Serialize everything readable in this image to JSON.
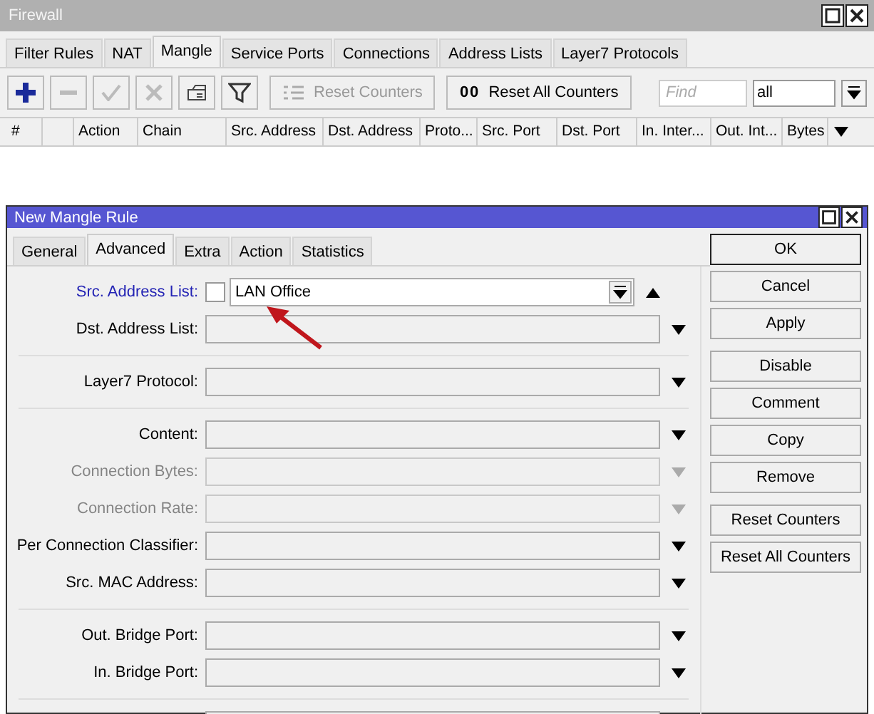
{
  "firewall": {
    "title": "Firewall",
    "tabs": [
      {
        "label": "Filter Rules",
        "selected": false
      },
      {
        "label": "NAT",
        "selected": false
      },
      {
        "label": "Mangle",
        "selected": true
      },
      {
        "label": "Service Ports",
        "selected": false
      },
      {
        "label": "Connections",
        "selected": false
      },
      {
        "label": "Address Lists",
        "selected": false
      },
      {
        "label": "Layer7 Protocols",
        "selected": false
      }
    ],
    "toolbar": [
      {
        "kind": "add",
        "disabled": false
      },
      {
        "kind": "remove",
        "disabled": true
      },
      {
        "kind": "enable",
        "disabled": true
      },
      {
        "kind": "disable",
        "disabled": true
      },
      {
        "kind": "comment",
        "disabled": false
      },
      {
        "kind": "filter",
        "disabled": false
      },
      {
        "kind": "reset",
        "label": "Reset Counters",
        "disabled": true
      },
      {
        "kind": "reset_all",
        "label": "Reset All Counters",
        "icon_text": "00",
        "disabled": false
      }
    ],
    "find": {
      "placeholder": "Find"
    },
    "filter": {
      "value": "all"
    },
    "columns": [
      "#",
      "",
      "Action",
      "Chain",
      "Src. Address",
      "Dst. Address",
      "Proto...",
      "Src. Port",
      "Dst. Port",
      "In. Inter...",
      "Out. Int...",
      "Bytes"
    ]
  },
  "dialog": {
    "title": "New Mangle Rule",
    "tabs": [
      {
        "label": "General",
        "selected": false
      },
      {
        "label": "Advanced",
        "selected": true
      },
      {
        "label": "Extra",
        "selected": false
      },
      {
        "label": "Action",
        "selected": false
      },
      {
        "label": "Statistics",
        "selected": false
      }
    ],
    "groups": [
      [
        {
          "kind": "address_list",
          "label": "Src. Address List:",
          "active": true,
          "checked": false,
          "value": "LAN Office",
          "disabled": false
        },
        {
          "kind": "select",
          "label": "Dst. Address List:",
          "active": false,
          "disabled": false
        }
      ],
      [
        {
          "kind": "select",
          "label": "Layer7 Protocol:",
          "active": false,
          "disabled": false
        }
      ],
      [
        {
          "kind": "select",
          "label": "Content:",
          "active": false,
          "disabled": false
        },
        {
          "kind": "select",
          "label": "Connection Bytes:",
          "active": false,
          "disabled": true
        },
        {
          "kind": "select",
          "label": "Connection Rate:",
          "active": false,
          "disabled": true
        },
        {
          "kind": "select",
          "label": "Per Connection Classifier:",
          "active": false,
          "disabled": false
        },
        {
          "kind": "select",
          "label": "Src. MAC Address:",
          "active": false,
          "disabled": false
        }
      ],
      [
        {
          "kind": "select",
          "label": "Out. Bridge Port:",
          "active": false,
          "disabled": false
        },
        {
          "kind": "select",
          "label": "In. Bridge Port:",
          "active": false,
          "disabled": false
        }
      ],
      [
        {
          "kind": "select"
        }
      ]
    ],
    "buttons": [
      [
        {
          "label": "OK",
          "default": true
        },
        {
          "label": "Cancel",
          "default": false
        },
        {
          "label": "Apply",
          "default": false
        }
      ],
      [
        {
          "label": "Disable",
          "default": false
        },
        {
          "label": "Comment",
          "default": false
        },
        {
          "label": "Copy",
          "default": false
        },
        {
          "label": "Remove",
          "default": false
        }
      ],
      [
        {
          "label": "Reset Counters",
          "default": false
        },
        {
          "label": "Reset All Counters",
          "default": false
        }
      ]
    ]
  }
}
